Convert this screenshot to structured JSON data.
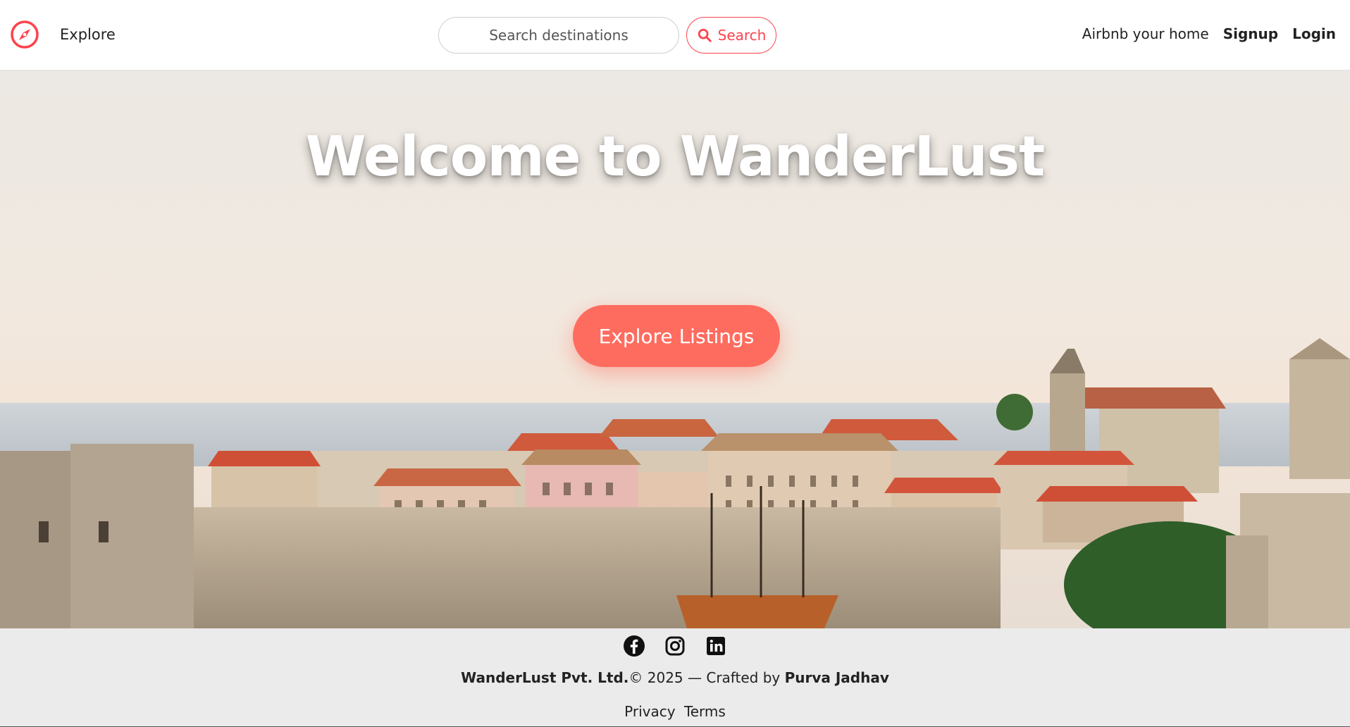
{
  "navbar": {
    "brand_icon": "compass-icon",
    "explore_label": "Explore",
    "search_placeholder": "Search destinations",
    "search_button_label": "Search",
    "search_icon": "magnifier-icon",
    "host_label": "Airbnb your home",
    "signup_label": "Signup",
    "login_label": "Login"
  },
  "hero": {
    "title": "Welcome to WanderLust",
    "cta_label": "Explore Listings"
  },
  "footer": {
    "social_icons": [
      "facebook-icon",
      "instagram-icon",
      "linkedin-icon"
    ],
    "company": "WanderLust Pvt. Ltd.",
    "copyright_mid": "© 2025 — Crafted by",
    "author": "Purva Jadhav",
    "links": [
      "Privacy",
      "Terms"
    ]
  },
  "colors": {
    "brand": "#fe424d",
    "cta": "#fe6c5f",
    "footer_bg": "#ebebeb"
  }
}
